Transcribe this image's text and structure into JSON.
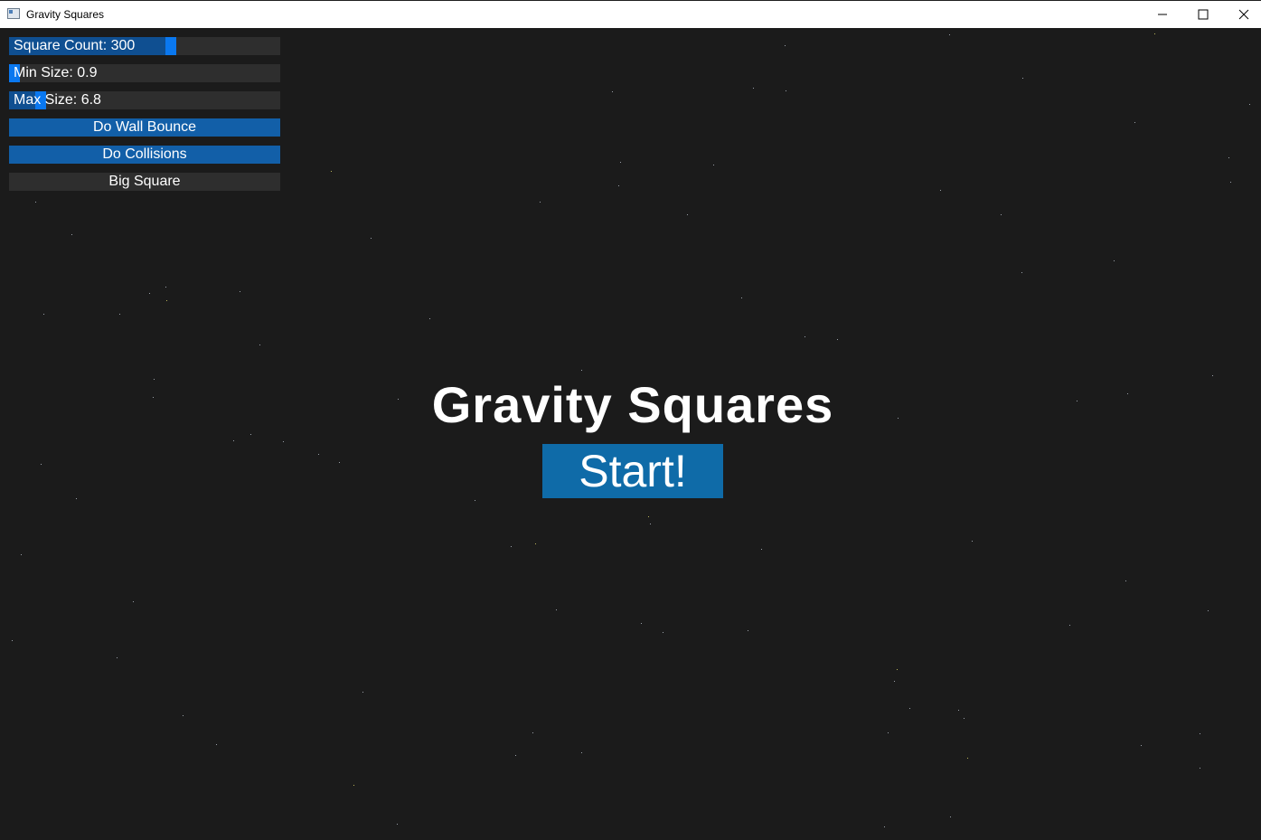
{
  "window": {
    "title": "Gravity Squares",
    "icons": [
      "app-icon",
      "minimize-icon",
      "maximize-icon",
      "close-icon"
    ]
  },
  "controls": {
    "square_count": {
      "label": "Square Count: 300",
      "value": 300,
      "level": 0.6
    },
    "min_size": {
      "label": "Min Size: 0.9",
      "value": 0.9,
      "level": 0.0
    },
    "max_size": {
      "label": "Max Size: 6.8",
      "value": 6.8,
      "level": 0.1
    },
    "wall_bounce": {
      "label": "Do Wall Bounce",
      "active": true
    },
    "collisions": {
      "label": "Do Collisions",
      "active": true
    },
    "big_square": {
      "label": "Big Square",
      "active": false
    }
  },
  "main": {
    "title": "Gravity Squares",
    "start_label": "Start!"
  },
  "colors": {
    "background": "#1b1b1b",
    "accent": "#0a78f0",
    "button_active": "#125fa8",
    "start_button": "#0f6ba8"
  }
}
